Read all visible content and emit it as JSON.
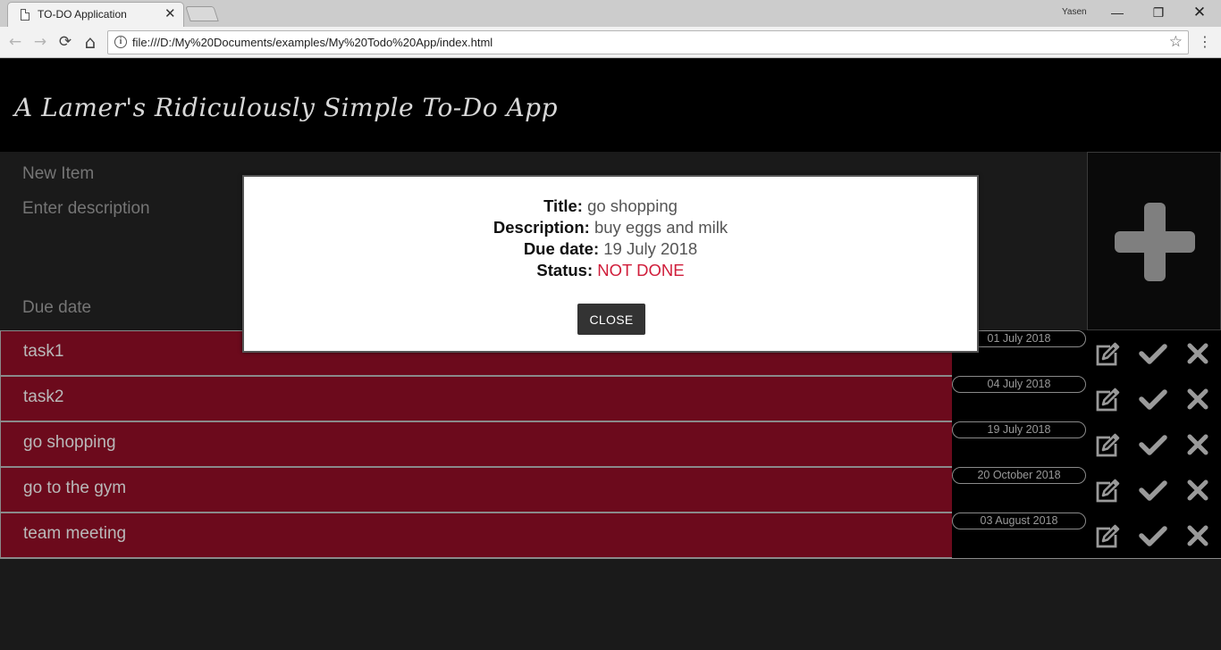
{
  "browser": {
    "tab_title": "TO-DO Application",
    "tab_close": "✕",
    "user_name": "Yasen",
    "url": "file:///D:/My%20Documents/examples/My%20Todo%20App/index.html",
    "window_controls": {
      "minimize": "—",
      "restore": "❐",
      "close": "✕"
    },
    "nav": {
      "back": "←",
      "forward": "→",
      "reload": "⟳",
      "home": "⌂",
      "star": "☆",
      "menu": "⋮"
    }
  },
  "app": {
    "title": "A Lamer's Ridiculously Simple To-Do App",
    "form": {
      "title_placeholder": "New Item",
      "description_placeholder": "Enter description",
      "due_date_placeholder": "Due date"
    },
    "tasks": [
      {
        "title": "task1",
        "date": "01 July 2018"
      },
      {
        "title": "task2",
        "date": "04 July 2018"
      },
      {
        "title": "go shopping",
        "date": "19 July 2018"
      },
      {
        "title": "go to the gym",
        "date": "20 October 2018"
      },
      {
        "title": "team meeting",
        "date": "03 August 2018"
      }
    ]
  },
  "modal": {
    "title_label": "Title:",
    "title_value": "go shopping",
    "description_label": "Description:",
    "description_value": "buy eggs and milk",
    "due_label": "Due date:",
    "due_value": "19 July 2018",
    "status_label": "Status:",
    "status_value": "NOT DONE",
    "close_label": "CLOSE"
  },
  "colors": {
    "task_row": "#6c0a1c",
    "status_not_done": "#d01d3a",
    "icon_gray": "#9a9a9a"
  }
}
